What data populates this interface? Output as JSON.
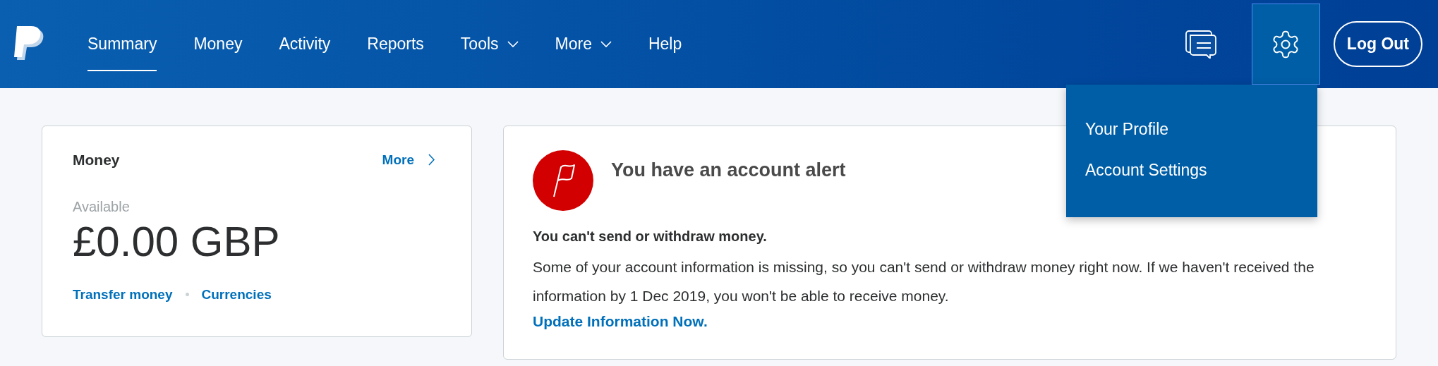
{
  "header": {
    "nav": [
      {
        "label": "Summary",
        "selected": true,
        "has_menu": false
      },
      {
        "label": "Money",
        "selected": false,
        "has_menu": false
      },
      {
        "label": "Activity",
        "selected": false,
        "has_menu": false
      },
      {
        "label": "Reports",
        "selected": false,
        "has_menu": false
      },
      {
        "label": "Tools",
        "selected": false,
        "has_menu": true
      },
      {
        "label": "More",
        "selected": false,
        "has_menu": true
      },
      {
        "label": "Help",
        "selected": false,
        "has_menu": false
      }
    ],
    "settings_expanded": true,
    "logout": "Log Out"
  },
  "settings_menu": [
    "Your Profile",
    "Account Settings"
  ],
  "money_card": {
    "title": "Money",
    "more": "More",
    "available_label": "Available",
    "balance": "£0.00 GBP",
    "links": [
      "Transfer money",
      "Currencies"
    ]
  },
  "alert_card": {
    "title": "You have an account alert",
    "heading": "You can't send or withdraw money.",
    "body": "Some of your account information is missing, so you can't send or withdraw money right now. If we haven't received the information by 1 Dec 2019, you won't be able to receive money.",
    "link": "Update Information Now."
  }
}
